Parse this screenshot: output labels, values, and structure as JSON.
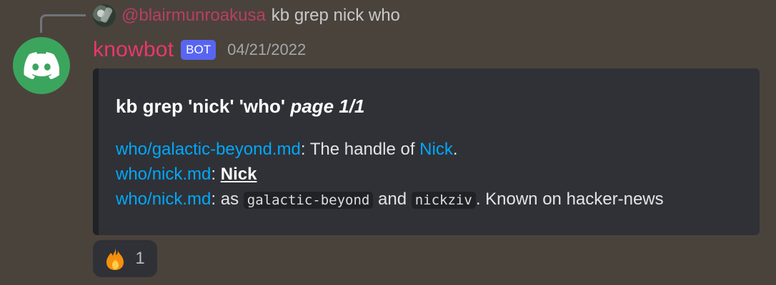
{
  "reply": {
    "author": "@blairmunroakusa",
    "text": "kb grep nick who"
  },
  "message": {
    "author": "knowbot",
    "bot_tag": "BOT",
    "timestamp": "04/21/2022",
    "avatar_icon": "discord-logo-icon"
  },
  "embed": {
    "title_main": "kb grep 'nick' 'who'",
    "title_italic": "page 1/1",
    "lines": [
      {
        "file": "who/galactic-beyond.md",
        "sep": ":",
        "text_before": " The handle of ",
        "link": "Nick",
        "text_after": "."
      },
      {
        "file": "who/nick.md",
        "sep": ":",
        "bold": "Nick"
      },
      {
        "file": "who/nick.md",
        "sep": ":",
        "text1": " as ",
        "code1": "galactic-beyond",
        "text2": " and ",
        "code2": "nickziv",
        "text3": ". Known on hacker-news"
      }
    ]
  },
  "reaction": {
    "emoji_icon": "fire-emoji-icon",
    "count": "1"
  },
  "colors": {
    "background": "#4a433b",
    "author": "#ea376c",
    "bot_tag": "#5865f2",
    "link": "#00a8fc",
    "embed_bg": "#2f3136",
    "avatar_bg": "#3ba55d"
  }
}
